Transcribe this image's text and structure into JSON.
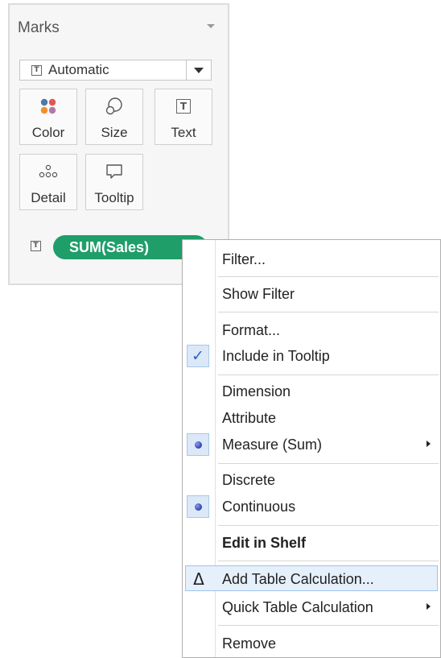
{
  "marks_card": {
    "title": "Marks",
    "mark_type": {
      "icon": "T",
      "label": "Automatic"
    },
    "buttons": [
      {
        "id": "color",
        "label": "Color",
        "icon": "color-dots-icon"
      },
      {
        "id": "size",
        "label": "Size",
        "icon": "size-icon"
      },
      {
        "id": "text",
        "label": "Text",
        "icon": "text-icon",
        "glyph": "T"
      },
      {
        "id": "detail",
        "label": "Detail",
        "icon": "detail-dots-icon"
      },
      {
        "id": "tooltip",
        "label": "Tooltip",
        "icon": "tooltip-icon"
      }
    ],
    "pill": {
      "icon": "T",
      "label": "SUM(Sales)",
      "color": "#1f9e6a"
    }
  },
  "context_menu": {
    "items": [
      {
        "label": "Filter..."
      },
      {
        "label": "Show Filter"
      },
      {
        "label": "Format..."
      },
      {
        "label": "Include in Tooltip",
        "checked": true,
        "check_glyph": "✓"
      },
      {
        "label": "Dimension"
      },
      {
        "label": "Attribute"
      },
      {
        "label": "Measure (Sum)",
        "selected": true,
        "submenu": true
      },
      {
        "label": "Discrete"
      },
      {
        "label": "Continuous",
        "selected": true
      },
      {
        "label": "Edit in Shelf",
        "bold": true
      },
      {
        "label": "Add Table Calculation...",
        "icon": "delta-icon",
        "glyph": "Δ",
        "highlighted": true
      },
      {
        "label": "Quick Table Calculation",
        "submenu": true
      },
      {
        "label": "Remove"
      }
    ]
  },
  "colors": {
    "pill_green": "#1f9e6a",
    "check_blue": "#2f63c1",
    "highlight_bg": "#e6f0fb",
    "highlight_border": "#9fc3ec",
    "radio_blue": "#3b4bb8"
  }
}
